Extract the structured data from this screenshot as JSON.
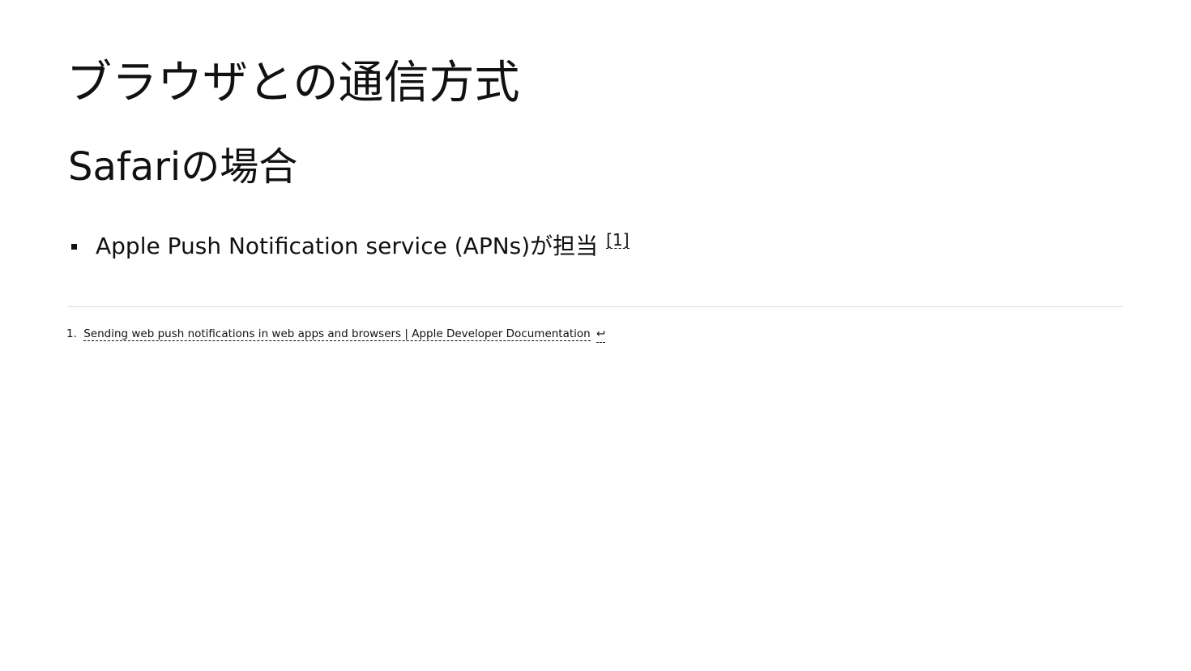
{
  "slide": {
    "title": "ブラウザとの通信方式",
    "subtitle": "Safariの場合",
    "bullets": [
      {
        "text": "Apple Push Notification service (APNs)が担当",
        "ref": "[1]"
      }
    ],
    "footnotes": [
      {
        "number": "1.",
        "text": "Sending web push notifications in web apps and browsers | Apple Developer Documentation",
        "backref": "↩"
      }
    ]
  }
}
